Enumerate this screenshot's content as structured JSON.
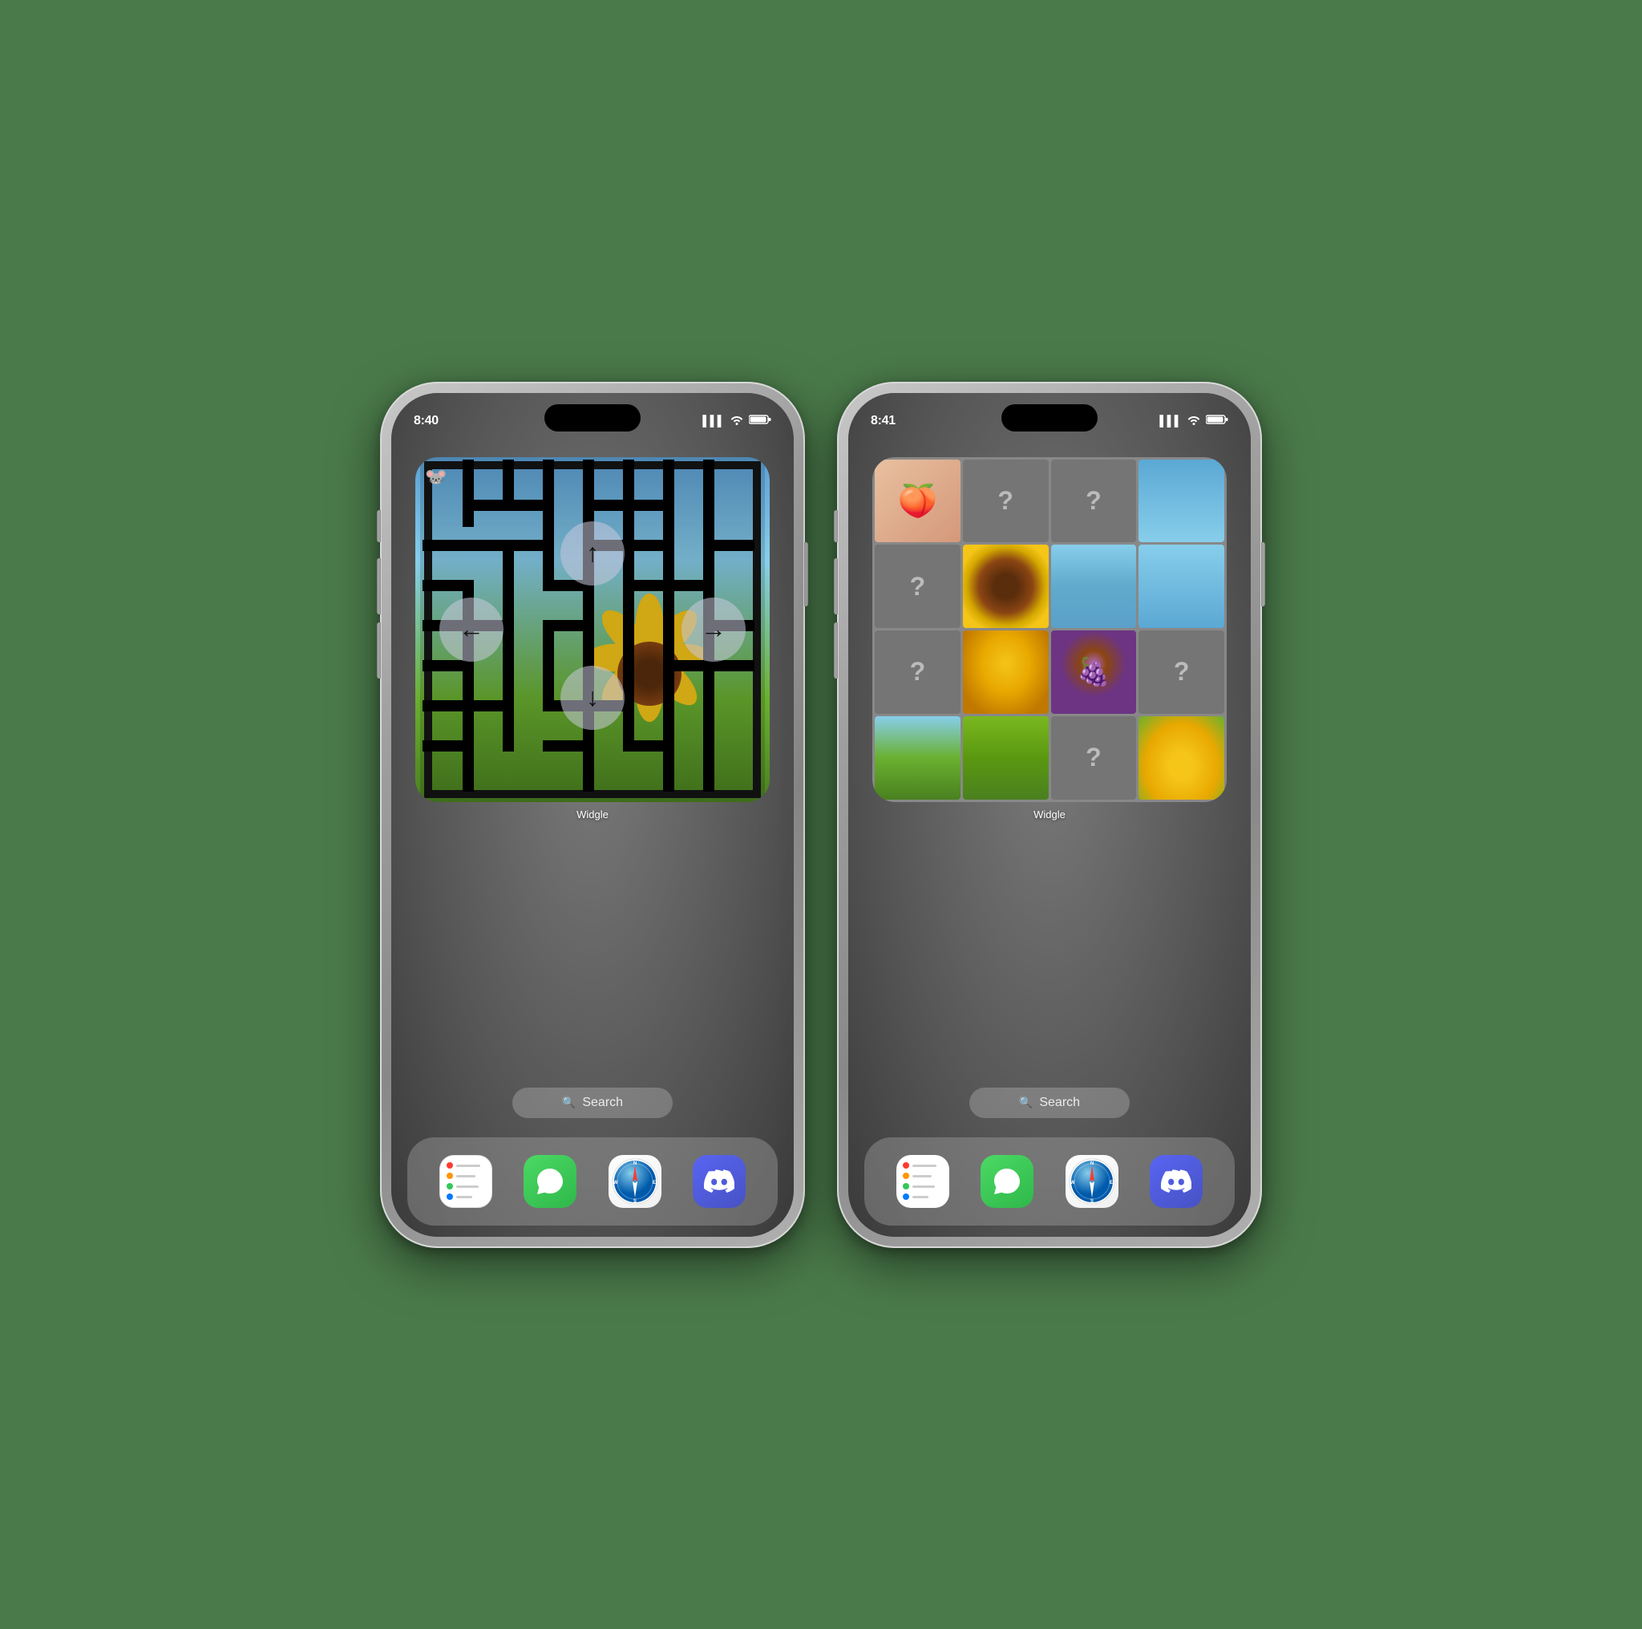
{
  "phones": [
    {
      "id": "phone-left",
      "time": "8:40",
      "time_icon": "☀",
      "widget_label": "Widgle",
      "search_label": "Search",
      "dock_icons": [
        "reminders",
        "messages",
        "safari",
        "discord"
      ],
      "widget_type": "maze"
    },
    {
      "id": "phone-right",
      "time": "8:41",
      "time_icon": "☀",
      "widget_label": "Widgle",
      "search_label": "Search",
      "dock_icons": [
        "reminders",
        "messages",
        "safari",
        "discord"
      ],
      "widget_type": "puzzle"
    }
  ],
  "maze": {
    "mouse_icon": "🐭",
    "arrow_up": "↑",
    "arrow_down": "↓",
    "arrow_left": "←",
    "arrow_right": "→"
  },
  "puzzle": {
    "question_mark": "?",
    "peach_emoji": "🍑",
    "grape_emoji": "🍇"
  },
  "status": {
    "signal": "▌▌▌",
    "wifi": "wifi",
    "battery": "▓▓▓"
  }
}
